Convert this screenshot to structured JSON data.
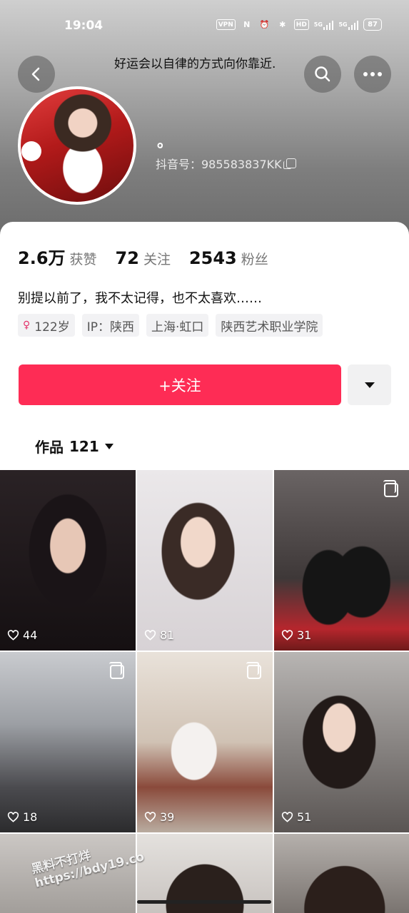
{
  "status_bar": {
    "time": "19:04",
    "vpn": "VPN",
    "nfc": "N",
    "hd": "HD",
    "signal1": "5G",
    "signal2": "5G",
    "battery": "87"
  },
  "header": {
    "slogan": "好运会以自律的方式向你靠近.",
    "nickname": "。",
    "douyin_id": "抖音号：985583837KK"
  },
  "stats": [
    {
      "value": "2.6万",
      "label": "获赞"
    },
    {
      "value": "72",
      "label": "关注"
    },
    {
      "value": "2543",
      "label": "粉丝"
    }
  ],
  "bio": "别提以前了，我不太记得，也不太喜欢……",
  "tags": {
    "age": "122岁",
    "ip": "IP：陕西",
    "location": "上海·虹口",
    "school": "陕西艺术职业学院"
  },
  "actions": {
    "follow_label": "+关注"
  },
  "works": {
    "label": "作品",
    "count": "121"
  },
  "videos": [
    {
      "likes": "44"
    },
    {
      "likes": "81"
    },
    {
      "likes": "31"
    },
    {
      "likes": "18"
    },
    {
      "likes": "39"
    },
    {
      "likes": "51"
    }
  ],
  "watermark": {
    "line1": "黑料不打烊",
    "line2": "https://bdy19.co"
  },
  "colors": {
    "accent": "#fe2c55",
    "tag_bg": "#f2f2f4",
    "header_top": "#cfcfcf",
    "header_bottom": "#6a6a6a"
  }
}
